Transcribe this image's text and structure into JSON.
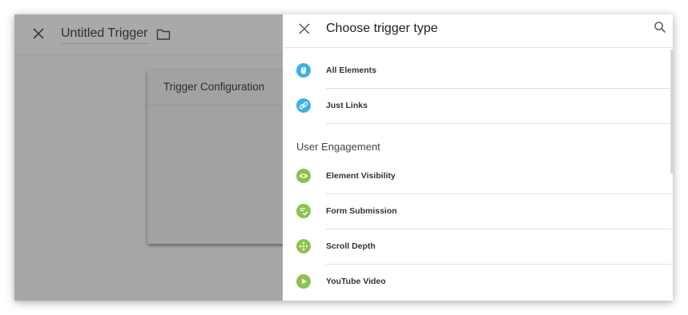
{
  "editor": {
    "title": "Untitled Trigger",
    "card_title": "Trigger Configuration"
  },
  "panel": {
    "title": "Choose trigger type",
    "clicks_items": [
      {
        "label": "All Elements",
        "icon": "all-elements-icon",
        "color": "#3cb0e5"
      },
      {
        "label": "Just Links",
        "icon": "link-icon",
        "color": "#3cb0e5"
      }
    ],
    "section_label": "User Engagement",
    "engagement_items": [
      {
        "label": "Element Visibility",
        "icon": "eye-icon",
        "color": "#8bc34a"
      },
      {
        "label": "Form Submission",
        "icon": "form-icon",
        "color": "#8bc34a"
      },
      {
        "label": "Scroll Depth",
        "icon": "scroll-icon",
        "color": "#8bc34a"
      },
      {
        "label": "YouTube Video",
        "icon": "play-icon",
        "color": "#8bc34a"
      }
    ]
  }
}
